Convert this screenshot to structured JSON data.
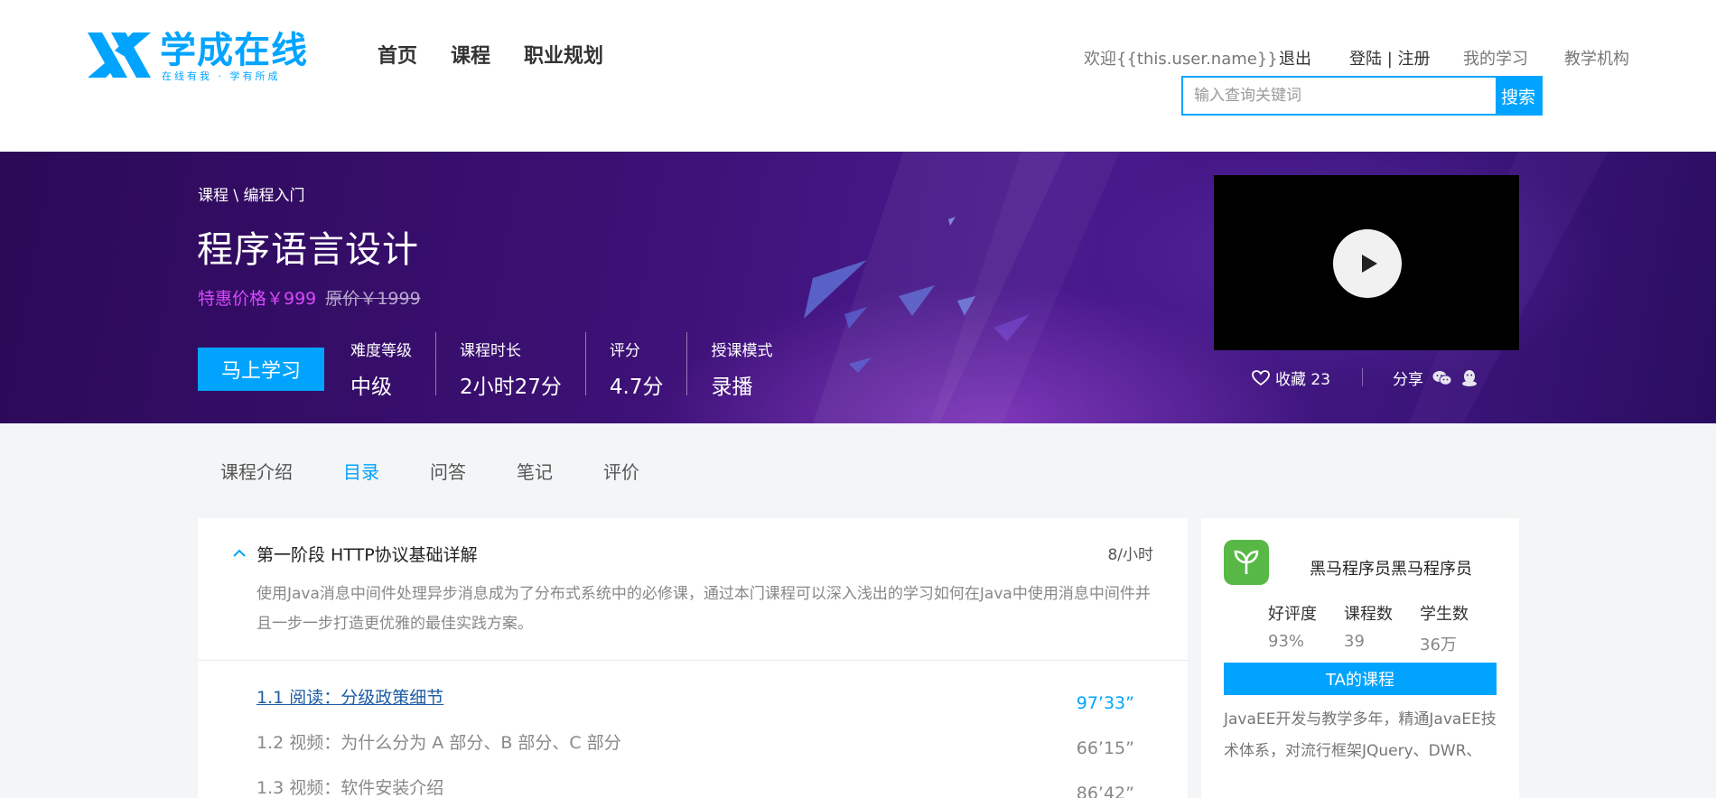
{
  "header": {
    "logo_text": "学成在线",
    "logo_slogan": "在线有我 · 学有所成",
    "nav": [
      "首页",
      "课程",
      "职业规划"
    ],
    "welcome": "欢迎{{this.user.name}}",
    "logout": "退出",
    "login_register": "登陆 | 注册",
    "my_learning": "我的学习",
    "institution": "教学机构",
    "search_placeholder": "输入查询关键词",
    "search_button": "搜索"
  },
  "banner": {
    "breadcrumb": "课程 \\ 编程入门",
    "title": "程序语言设计",
    "sale_price": "特惠价格￥999",
    "original_price": "原价￥1999",
    "study_button": "马上学习",
    "stats": [
      {
        "label": "难度等级",
        "value": "中级"
      },
      {
        "label": "课程时长",
        "value": "2小时27分"
      },
      {
        "label": "评分",
        "value": "4.7分"
      },
      {
        "label": "授课模式",
        "value": "录播"
      }
    ],
    "favorite_label": "收藏 23",
    "share_label": "分享"
  },
  "tabs": [
    {
      "label": "课程介绍",
      "active": false
    },
    {
      "label": "目录",
      "active": true
    },
    {
      "label": "问答",
      "active": false
    },
    {
      "label": "笔记",
      "active": false
    },
    {
      "label": "评价",
      "active": false
    }
  ],
  "catalog": {
    "chapter": {
      "title": "第一阶段 HTTP协议基础详解",
      "duration": "8/小时",
      "description": "使用Java消息中间件处理异步消息成为了分布式系统中的必修课，通过本门课程可以深入浅出的学习如何在Java中使用消息中间件并且一步一步打造更优雅的最佳实践方案。"
    },
    "lessons": [
      {
        "title": "1.1 阅读：分级政策细节",
        "time": "97’33”",
        "active": true
      },
      {
        "title": "1.2 视频：为什么分为 A 部分、B 部分、C 部分",
        "time": "66’15”",
        "active": false
      },
      {
        "title": "1.3 视频：软件安装介绍",
        "time": "86’42”",
        "active": false
      }
    ]
  },
  "teacher": {
    "name": "黑马程序员黑马程序员",
    "stats": [
      {
        "label": "好评度",
        "value": "93%"
      },
      {
        "label": "课程数",
        "value": "39"
      },
      {
        "label": "学生数",
        "value": "36万"
      }
    ],
    "courses_button": "TA的课程",
    "description": "JavaEE开发与教学多年，精通JavaEE技术体系，对流行框架JQuery、DWR、"
  },
  "colors": {
    "accent": "#00a4ff",
    "sale_price": "#d848ff",
    "banner_dark": "#2c0a57",
    "avatar_green": "#58b846"
  }
}
